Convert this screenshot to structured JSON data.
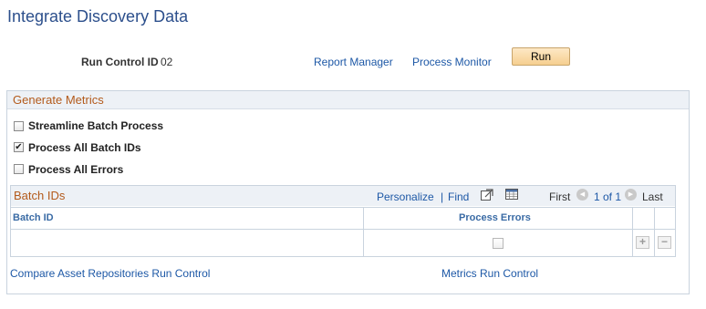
{
  "page": {
    "title": "Integrate Discovery Data"
  },
  "run_control": {
    "label": "Run Control ID",
    "value": "02",
    "report_manager": "Report Manager",
    "process_monitor": "Process Monitor",
    "run_button": "Run"
  },
  "generate_metrics": {
    "title": "Generate Metrics",
    "options": [
      {
        "label": "Streamline Batch Process",
        "checked": false
      },
      {
        "label": "Process All Batch IDs",
        "checked": true
      },
      {
        "label": "Process All Errors",
        "checked": false
      }
    ]
  },
  "batch_grid": {
    "title": "Batch IDs",
    "personalize": "Personalize",
    "separator": "|",
    "find": "Find",
    "first": "First",
    "page_info": "1 of 1",
    "last": "Last",
    "columns": [
      "Batch ID",
      "Process Errors"
    ],
    "rows": [
      {
        "batch_id": "",
        "process_errors": false
      }
    ],
    "add_row": "+",
    "delete_row": "−"
  },
  "footer_links": {
    "compare": "Compare Asset Repositories Run Control",
    "metrics": "Metrics Run Control"
  }
}
